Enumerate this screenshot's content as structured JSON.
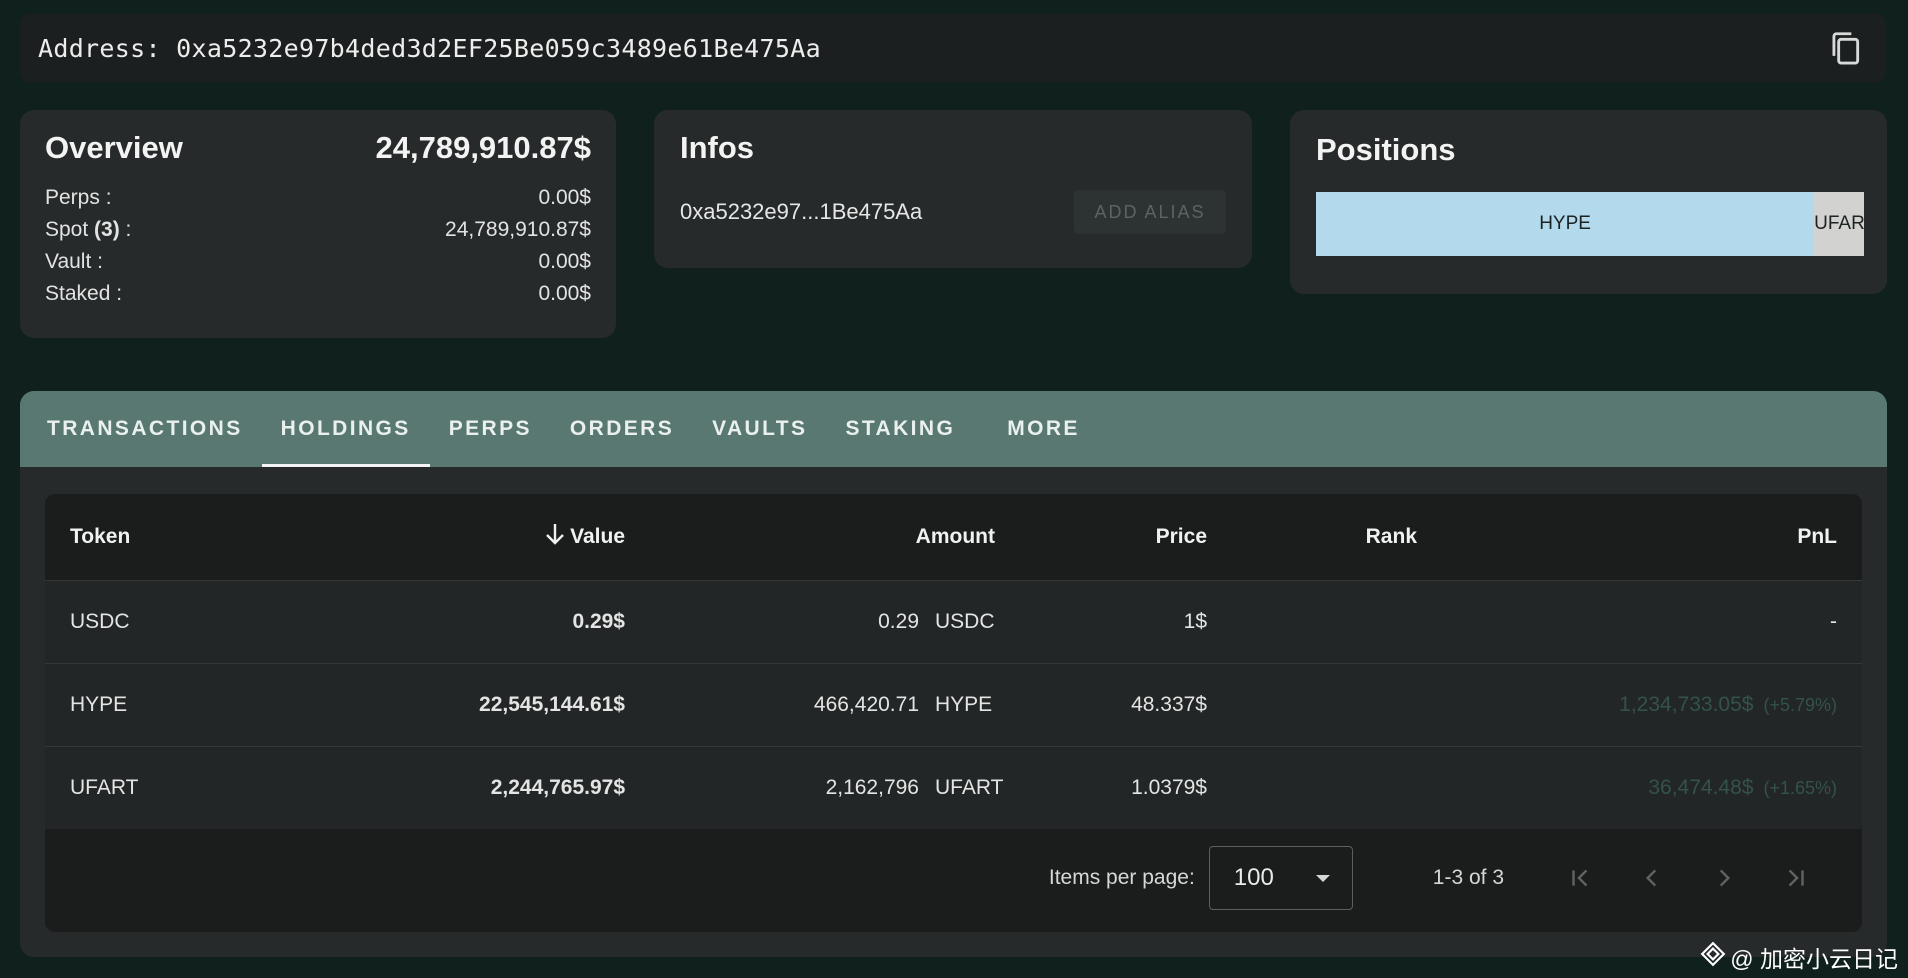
{
  "address_bar": {
    "label": "Address:",
    "address": "0xa5232e97b4ded3d2EF25Be059c3489e61Be475Aa"
  },
  "overview": {
    "title": "Overview",
    "total": "24,789,910.87$",
    "rows": [
      {
        "label": "Perps :",
        "value": "0.00$"
      },
      {
        "label_prefix": "Spot ",
        "label_count": "(3)",
        "label_suffix": " :",
        "value": "24,789,910.87$"
      },
      {
        "label": "Vault :",
        "value": "0.00$"
      },
      {
        "label": "Staked :",
        "value": "0.00$"
      }
    ]
  },
  "infos": {
    "title": "Infos",
    "short_address": "0xa5232e97...1Be475Aa",
    "alias_button": "ADD ALIAS"
  },
  "positions": {
    "title": "Positions",
    "segments": [
      {
        "label": "HYPE",
        "fraction": 0.909,
        "color": "#b2d9ec"
      },
      {
        "label": "UFART",
        "fraction": 0.091,
        "color": "#d2d2d0"
      }
    ]
  },
  "tabs": [
    "TRANSACTIONS",
    "HOLDINGS",
    "PERPS",
    "ORDERS",
    "VAULTS",
    "STAKING",
    "MORE"
  ],
  "active_tab": "HOLDINGS",
  "table": {
    "headers": {
      "token": "Token",
      "value": "Value",
      "amount": "Amount",
      "price": "Price",
      "rank": "Rank",
      "pnl": "PnL"
    },
    "rows": [
      {
        "token": "USDC",
        "value": "0.29$",
        "amount": "0.29",
        "symbol": "USDC",
        "price": "1$",
        "rank": "",
        "pnl": "-",
        "pnl_pct": ""
      },
      {
        "token": "HYPE",
        "value": "22,545,144.61$",
        "amount": "466,420.71",
        "symbol": "HYPE",
        "price": "48.337$",
        "rank": "",
        "pnl": "1,234,733.05$",
        "pnl_pct": "(+5.79%)"
      },
      {
        "token": "UFART",
        "value": "2,244,765.97$",
        "amount": "2,162,796",
        "symbol": "UFART",
        "price": "1.0379$",
        "rank": "",
        "pnl": "36,474.48$",
        "pnl_pct": "(+1.65%)"
      }
    ]
  },
  "pagination": {
    "items_label": "Items per page:",
    "items_value": "100",
    "range": "1-3 of 3"
  },
  "watermark": "@ 加密小云日记",
  "colors": {
    "background": "#0f201d",
    "card": "#262a2a",
    "tabbar": "#597872",
    "pnl": "#33524b"
  },
  "icons": [
    "copy-icon",
    "sort-down-arrow-icon",
    "dropdown-caret-icon",
    "first-page-icon",
    "previous-page-icon",
    "next-page-icon",
    "last-page-icon",
    "watermark-logo-icon"
  ]
}
